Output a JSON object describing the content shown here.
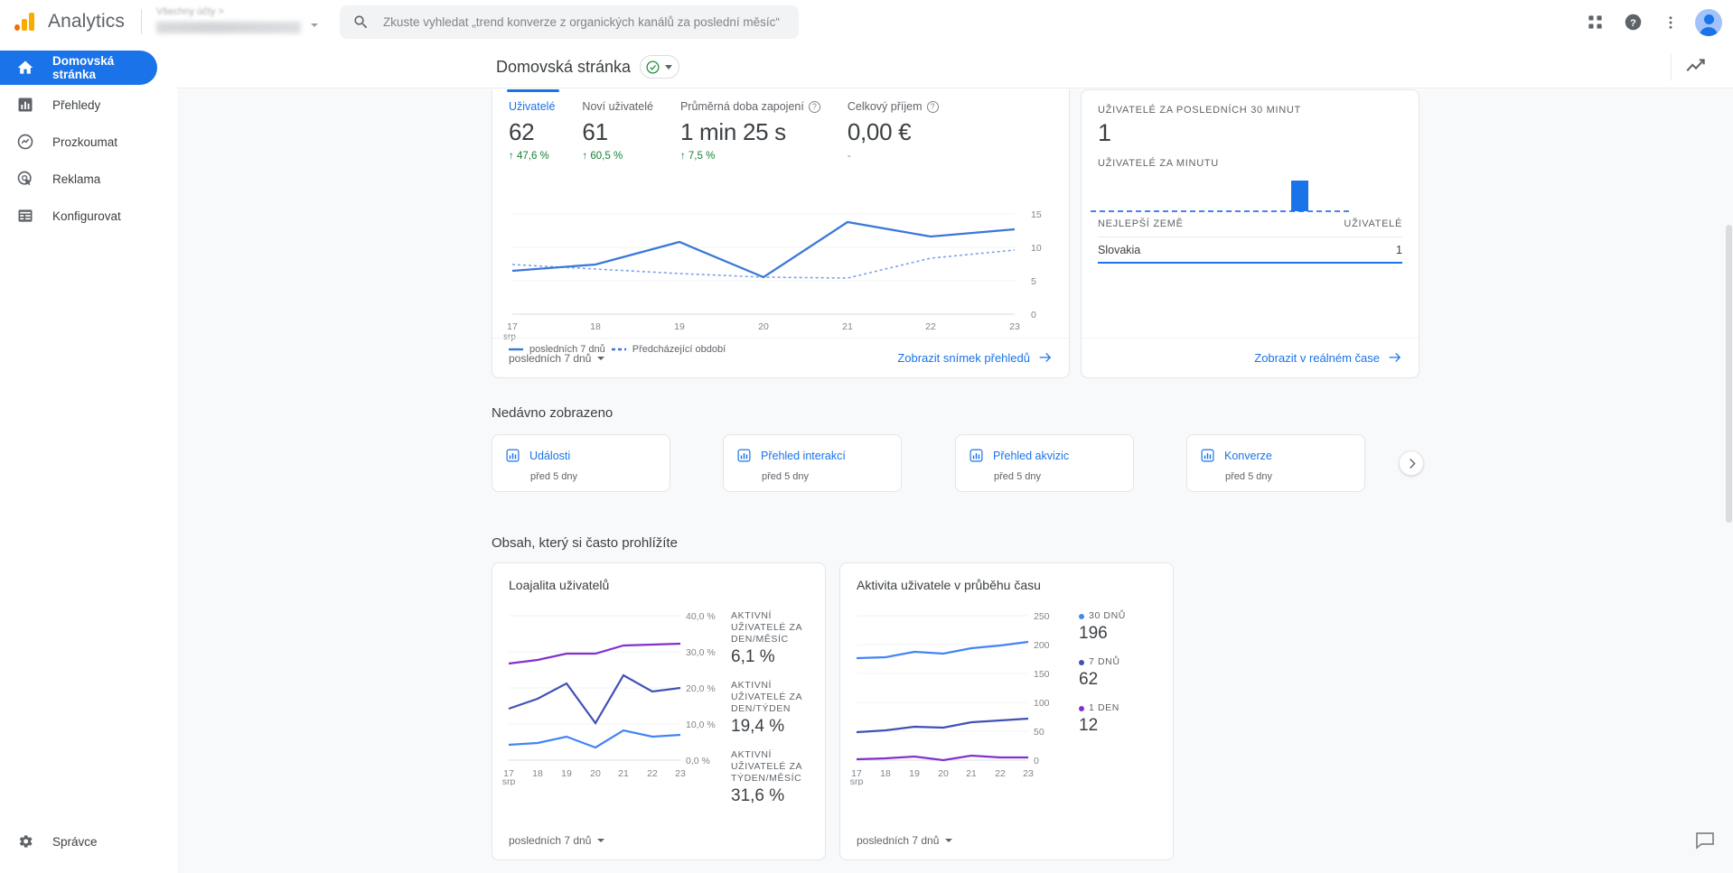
{
  "topbar": {
    "brand": "Analytics",
    "account_breadcrumb": "Všechny účty > ",
    "search_placeholder": "Zkuste vyhledat „trend konverze z organických kanálů za poslední měsíc“",
    "search_value": "",
    "icons": {
      "search": "search-icon",
      "apps": "apps-grid-icon",
      "help": "help-icon",
      "more": "more-vert-icon",
      "avatar": "avatar"
    }
  },
  "sidebar": {
    "items": [
      {
        "label": "Domovská stránka",
        "icon": "home-icon",
        "active": true
      },
      {
        "label": "Přehledy",
        "icon": "bar-chart-icon",
        "active": false
      },
      {
        "label": "Prozkoumat",
        "icon": "explore-icon",
        "active": false
      },
      {
        "label": "Reklama",
        "icon": "ads-icon",
        "active": false
      },
      {
        "label": "Konfigurovat",
        "icon": "configure-list-icon",
        "active": false
      }
    ],
    "admin": {
      "label": "Správce",
      "icon": "gear-icon"
    }
  },
  "page_header": {
    "title": "Domovská stránka",
    "badge_icon": "check-circle-icon",
    "chip_caret": "chevron-down-icon",
    "insights_icon": "insights-trend-icon"
  },
  "overview": {
    "metrics": [
      {
        "label": "Uživatelé",
        "value": "62",
        "delta": "47,6 %",
        "delta_dir": "up",
        "active": true,
        "has_help": false
      },
      {
        "label": "Noví uživatelé",
        "value": "61",
        "delta": "60,5 %",
        "delta_dir": "up",
        "active": false,
        "has_help": false
      },
      {
        "label": "Průměrná doba zapojení",
        "value": "1 min 25 s",
        "delta": "7,5 %",
        "delta_dir": "up",
        "active": false,
        "has_help": true
      },
      {
        "label": "Celkový příjem",
        "value": "0,00 €",
        "delta": "-",
        "delta_dir": "none",
        "active": false,
        "has_help": true
      }
    ],
    "footer_range": "posledních 7 dnů",
    "footer_link": "Zobrazit snímek přehledů"
  },
  "realtime": {
    "label_30min": "UŽIVATELÉ ZA POSLEDNÍCH 30 MINUT",
    "value_30min": "1",
    "label_per_minute": "UŽIVATELÉ ZA MINUTU",
    "table_head_country": "NEJLEPŠÍ ZEMĚ",
    "table_head_users": "UŽIVATELÉ",
    "rows": [
      {
        "country": "Slovakia",
        "users": "1"
      }
    ],
    "footer_link": "Zobrazit v reálném čase"
  },
  "recent": {
    "section_title": "Nedávno zobrazeno",
    "cards": [
      {
        "title": "Události",
        "sub": "před 5 dny",
        "icon": "report-bar-icon"
      },
      {
        "title": "Přehled interakcí",
        "sub": "před 5 dny",
        "icon": "report-bar-icon"
      },
      {
        "title": "Přehled akvizic",
        "sub": "před 5 dny",
        "icon": "report-bar-icon"
      },
      {
        "title": "Konverze",
        "sub": "před 5 dny",
        "icon": "report-bar-icon"
      }
    ],
    "next_icon": "chevron-right-icon"
  },
  "frequent": {
    "section_title": "Obsah, který si často prohlížíte",
    "loyalty": {
      "title": "Loajalita uživatelů",
      "footer_range": "posledních 7 dnů"
    },
    "activity": {
      "title": "Aktivita uživatele v průběhu času",
      "footer_range": "posledních 7 dnů"
    }
  },
  "feedback": {
    "icon": "feedback-icon"
  },
  "chart_data": [
    {
      "type": "line",
      "id": "overview-users-trend",
      "title": "",
      "xlabel": "",
      "ylabel": "",
      "categories": [
        "17",
        "18",
        "19",
        "20",
        "21",
        "22",
        "23"
      ],
      "x_axis_unit": "srp",
      "ylim": [
        0,
        15
      ],
      "yticks": [
        0,
        5,
        10,
        15
      ],
      "grid": true,
      "legend": [
        "posledních 7 dnů",
        "Předcházející období"
      ],
      "legend_position": "bottom-left",
      "series": [
        {
          "name": "posledních 7 dnů",
          "style": "solid",
          "color": "#4285f4",
          "values": [
            6.5,
            7.5,
            10.8,
            5.5,
            13.8,
            11.7,
            12.7
          ]
        },
        {
          "name": "Předcházející období",
          "style": "dashed",
          "color": "#6f9ce8",
          "values": [
            7.5,
            6.9,
            6.1,
            5.6,
            5.5,
            8.4,
            9.6
          ]
        }
      ]
    },
    {
      "type": "bar",
      "id": "realtime-users-per-minute",
      "title": "UŽIVATELÉ ZA MINUTU",
      "categories": [
        "-30",
        "-29",
        "-28",
        "-27",
        "-26",
        "-25",
        "-24",
        "-23",
        "-22",
        "-21",
        "-20",
        "-19",
        "-18",
        "-17",
        "-16",
        "-15",
        "-14",
        "-13",
        "-12",
        "-11",
        "-10",
        "-9",
        "-8",
        "-7",
        "-6",
        "-5",
        "-4",
        "-3",
        "-2",
        "-1"
      ],
      "values": [
        0,
        0,
        0,
        0,
        0,
        0,
        0,
        0,
        0,
        0,
        0,
        0,
        0,
        0,
        0,
        0,
        0,
        0,
        0,
        0,
        0,
        0,
        0,
        0,
        0,
        1,
        0,
        0,
        0,
        0
      ],
      "ylim": [
        0,
        1
      ],
      "color": "#1a73e8"
    },
    {
      "type": "line",
      "id": "user-loyalty",
      "title": "Loajalita uživatelů",
      "categories": [
        "17",
        "18",
        "19",
        "20",
        "21",
        "22",
        "23"
      ],
      "x_axis_unit": "srp",
      "ylim": [
        0,
        40
      ],
      "yticks": [
        0,
        10,
        20,
        30,
        40
      ],
      "ytick_labels": [
        "0,0 %",
        "10,0 %",
        "20,0 %",
        "30,0 %",
        "40,0 %"
      ],
      "grid": true,
      "legend_position": "right",
      "series": [
        {
          "name": "AKTIVNÍ UŽIVATELÉ ZA DEN/MĚSÍC",
          "color": "#4285f4",
          "current": "6,1 %",
          "values": [
            4.2,
            4.8,
            6.4,
            3.6,
            8.2,
            6.6,
            7.1
          ]
        },
        {
          "name": "AKTIVNÍ UŽIVATELÉ ZA DEN/TÝDEN",
          "color": "#3f51b5",
          "current": "19,4 %",
          "values": [
            14.2,
            17.0,
            21.2,
            10.2,
            23.4,
            18.8,
            20.1
          ]
        },
        {
          "name": "AKTIVNÍ UŽIVATELÉ ZA TÝDEN/MĚSÍC",
          "color": "#8430ce",
          "current": "31,6 %",
          "values": [
            26.8,
            28.0,
            29.5,
            29.5,
            31.7,
            32.0,
            32.2
          ]
        }
      ]
    },
    {
      "type": "line",
      "id": "user-activity-over-time",
      "title": "Aktivita uživatele v průběhu času",
      "categories": [
        "17",
        "18",
        "19",
        "20",
        "21",
        "22",
        "23"
      ],
      "x_axis_unit": "srp",
      "ylim": [
        0,
        250
      ],
      "yticks": [
        0,
        50,
        100,
        150,
        200,
        250
      ],
      "grid": true,
      "legend_position": "right",
      "series": [
        {
          "name": "30 DNŮ",
          "color": "#4285f4",
          "current": "196",
          "values": [
            176,
            178,
            187,
            185,
            194,
            199,
            205
          ]
        },
        {
          "name": "7 DNŮ",
          "color": "#3f51b5",
          "current": "62",
          "values": [
            49,
            52,
            58,
            57,
            66,
            68,
            71
          ]
        },
        {
          "name": "1 DEN",
          "color": "#8430ce",
          "current": "12",
          "values": [
            2,
            3,
            5,
            1,
            8,
            6,
            6
          ]
        }
      ]
    }
  ]
}
